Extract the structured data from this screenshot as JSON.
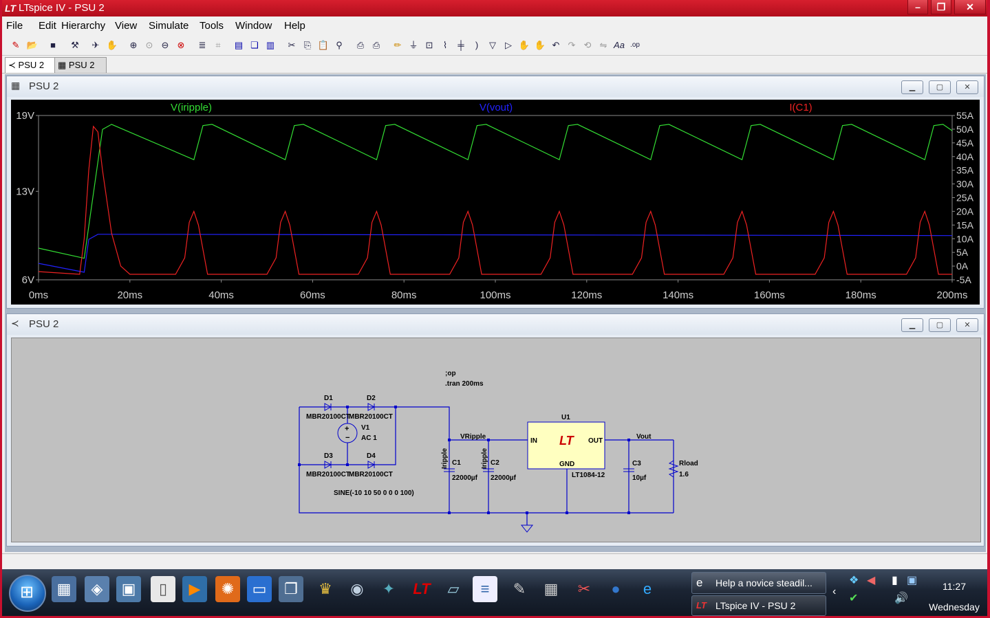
{
  "window": {
    "title": "LTspice IV - PSU 2",
    "title_icon": "lt-logo-icon",
    "buttons": [
      "–",
      "❐",
      "✕"
    ]
  },
  "menu": [
    "File",
    "Edit",
    "Hierarchy",
    "View",
    "Simulate",
    "Tools",
    "Window",
    "Help"
  ],
  "toolbar_icons": [
    "new-schematic-icon",
    "open-icon",
    "save-icon",
    "control-panel-icon",
    "run-icon",
    "halt-icon",
    "zoom-in-icon",
    "zoom-area-icon",
    "zoom-out-icon",
    "zoom-cancel-icon",
    "autorange-icon",
    "mark-unref-icon",
    "tile-horizontal-icon",
    "cascade-icon",
    "tile-vertical-icon",
    "cut-icon",
    "copy-icon",
    "paste-icon",
    "find-icon",
    "print-setup-icon",
    "print-icon",
    "wire-icon",
    "ground-icon",
    "label-net-icon",
    "resistor-icon",
    "capacitor-icon",
    "inductor-icon",
    "diode-icon",
    "component-icon",
    "move-icon",
    "drag-icon",
    "undo-icon",
    "redo-icon",
    "rotate-icon",
    "mirror-icon",
    "text-icon",
    "spice-directive-icon"
  ],
  "tabs": [
    {
      "label": "PSU 2",
      "icon": "schematic-icon"
    },
    {
      "label": "PSU 2",
      "icon": "waveform-icon"
    }
  ],
  "waveform_window": {
    "title": "PSU 2",
    "icon": "waveform-icon",
    "chart_data": {
      "type": "line",
      "title": "",
      "xlabel": "",
      "ylabel": "",
      "xlim": [
        0,
        200
      ],
      "ylim_left": [
        6,
        19
      ],
      "ylim_right": [
        -5,
        55
      ],
      "x_ticks": [
        "0ms",
        "20ms",
        "40ms",
        "60ms",
        "80ms",
        "100ms",
        "120ms",
        "140ms",
        "160ms",
        "180ms",
        "200ms"
      ],
      "y_ticks_left": [
        "19V",
        "13V",
        "6V"
      ],
      "y_ticks_right": [
        "55A",
        "50A",
        "45A",
        "40A",
        "35A",
        "30A",
        "25A",
        "20A",
        "15A",
        "10A",
        "5A",
        "0A",
        "-5A"
      ],
      "grid": false,
      "series": [
        {
          "name": "V(iripple)",
          "axis": "left",
          "color": "#33dd33",
          "x": [
            0,
            10,
            14,
            16,
            34,
            36,
            38,
            54,
            56,
            58,
            74,
            76,
            78,
            94,
            96,
            98,
            114,
            116,
            118,
            134,
            136,
            138,
            154,
            156,
            158,
            174,
            176,
            178,
            194,
            196,
            198,
            200
          ],
          "y": [
            8.5,
            7.7,
            17.9,
            18.3,
            15.5,
            18.2,
            18.3,
            15.5,
            18.2,
            18.3,
            15.5,
            18.2,
            18.3,
            15.5,
            18.2,
            18.3,
            15.5,
            18.2,
            18.3,
            15.5,
            18.2,
            18.3,
            15.5,
            18.2,
            18.3,
            15.5,
            18.2,
            18.3,
            15.5,
            18.2,
            18.3,
            17.8
          ]
        },
        {
          "name": "V(vout)",
          "axis": "left",
          "color": "#2222ff",
          "x": [
            0,
            10,
            11,
            13,
            15,
            200
          ],
          "y": [
            7.3,
            6.6,
            9.2,
            9.6,
            9.6,
            9.5
          ]
        },
        {
          "name": "I(C1)",
          "axis": "right",
          "color": "#ee2222",
          "x": [
            0,
            9,
            10,
            11,
            12,
            13,
            14,
            16,
            18,
            20,
            30,
            32,
            33,
            34,
            35,
            37,
            50,
            52,
            53,
            54,
            55,
            57,
            70,
            72,
            73,
            74,
            75,
            77,
            90,
            92,
            93,
            94,
            95,
            97,
            110,
            112,
            113,
            114,
            115,
            117,
            130,
            132,
            133,
            134,
            135,
            137,
            150,
            152,
            153,
            154,
            155,
            157,
            170,
            172,
            173,
            174,
            175,
            177,
            190,
            192,
            193,
            194,
            195,
            197,
            200
          ],
          "y": [
            -2,
            -3,
            10,
            35,
            51,
            49,
            35,
            12,
            0,
            -3,
            -3,
            3,
            16,
            20,
            15,
            -3,
            -3,
            3,
            16,
            20,
            15,
            -3,
            -3,
            3,
            16,
            20,
            15,
            -3,
            -3,
            3,
            16,
            20,
            15,
            -3,
            -3,
            3,
            16,
            20,
            15,
            -3,
            -3,
            3,
            16,
            20,
            15,
            -3,
            -3,
            3,
            16,
            20,
            15,
            -3,
            -3,
            3,
            16,
            20,
            15,
            -3,
            -3,
            3,
            16,
            20,
            15,
            -3,
            -3
          ]
        }
      ]
    }
  },
  "schematic_window": {
    "title": "PSU 2",
    "icon": "schematic-icon",
    "directives": [
      ";op",
      ".tran 200ms"
    ],
    "components": {
      "D1": {
        "ref": "D1",
        "value": "MBR20100CT"
      },
      "D2": {
        "ref": "D2",
        "value": "MBR20100CT"
      },
      "D3": {
        "ref": "D3",
        "value": "MBR20100CT"
      },
      "D4": {
        "ref": "D4",
        "value": "MBR20100CT"
      },
      "V1": {
        "ref": "V1",
        "value": "AC 1",
        "source": "SINE(-10 10 50 0 0 0 100)"
      },
      "C1": {
        "ref": "C1",
        "value": "22000µf"
      },
      "C2": {
        "ref": "C2",
        "value": "22000µf"
      },
      "U1": {
        "ref": "U1",
        "part": "LT1084-12",
        "pin_in": "IN",
        "pin_out": "OUT",
        "pin_gnd": "GND"
      },
      "C3": {
        "ref": "C3",
        "value": "10µf"
      },
      "Rload": {
        "ref": "Rload",
        "value": "1.6"
      }
    },
    "nets": {
      "vripple": "VRipple",
      "iripple1": "Iripple",
      "iripple2": "Iripple",
      "vout": "Vout"
    }
  },
  "taskbar": {
    "windows": [
      {
        "label": "Help a novice steadil...",
        "icon": "ie-icon"
      },
      {
        "label": "LTspice IV - PSU 2",
        "icon": "lt-logo-icon"
      }
    ],
    "clock_time": "11:27",
    "clock_day": "Wednesday"
  }
}
